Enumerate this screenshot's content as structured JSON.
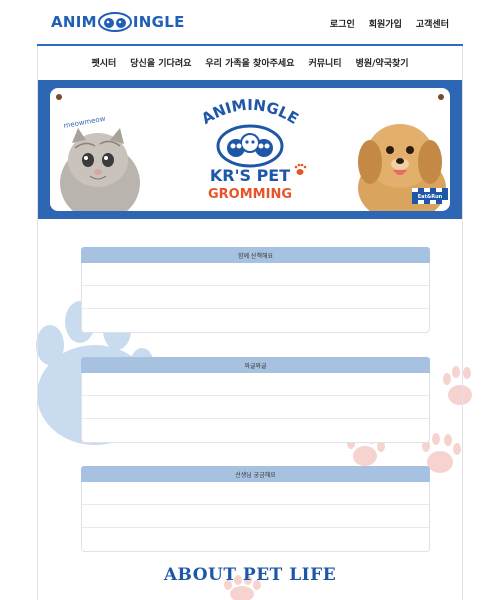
{
  "header": {
    "logo_left": "ANIM",
    "logo_right": "INGLE",
    "links": [
      "로그인",
      "회원가입",
      "고객센터"
    ]
  },
  "nav": {
    "items": [
      "펫시터",
      "당신을 기다려요",
      "우리 가족을 찾아주세요",
      "커뮤니티",
      "병원/약국찾기"
    ]
  },
  "banner": {
    "brand_arc": "ANIMINGLE",
    "title_line1": "KR'S PET",
    "title_line2": "GROMMING",
    "cat_caption": "meowmeow",
    "dog_badge": "Eat&Run",
    "colors": {
      "frame": "#2d67b3",
      "title_blue": "#1f57a8",
      "title_orange": "#e8542a"
    }
  },
  "sections": [
    {
      "title": "함께 산책해요",
      "rows": 3
    },
    {
      "title": "와글와글",
      "rows": 3
    },
    {
      "title": "선생님 궁금해요",
      "rows": 3
    }
  ],
  "about": {
    "title": "ABOUT PET LIFE"
  },
  "colors": {
    "accent": "#2f6bbf",
    "section_header": "#a7c2e0",
    "paw_blue": "#c9dbee",
    "paw_pink": "#f6d3cf"
  }
}
